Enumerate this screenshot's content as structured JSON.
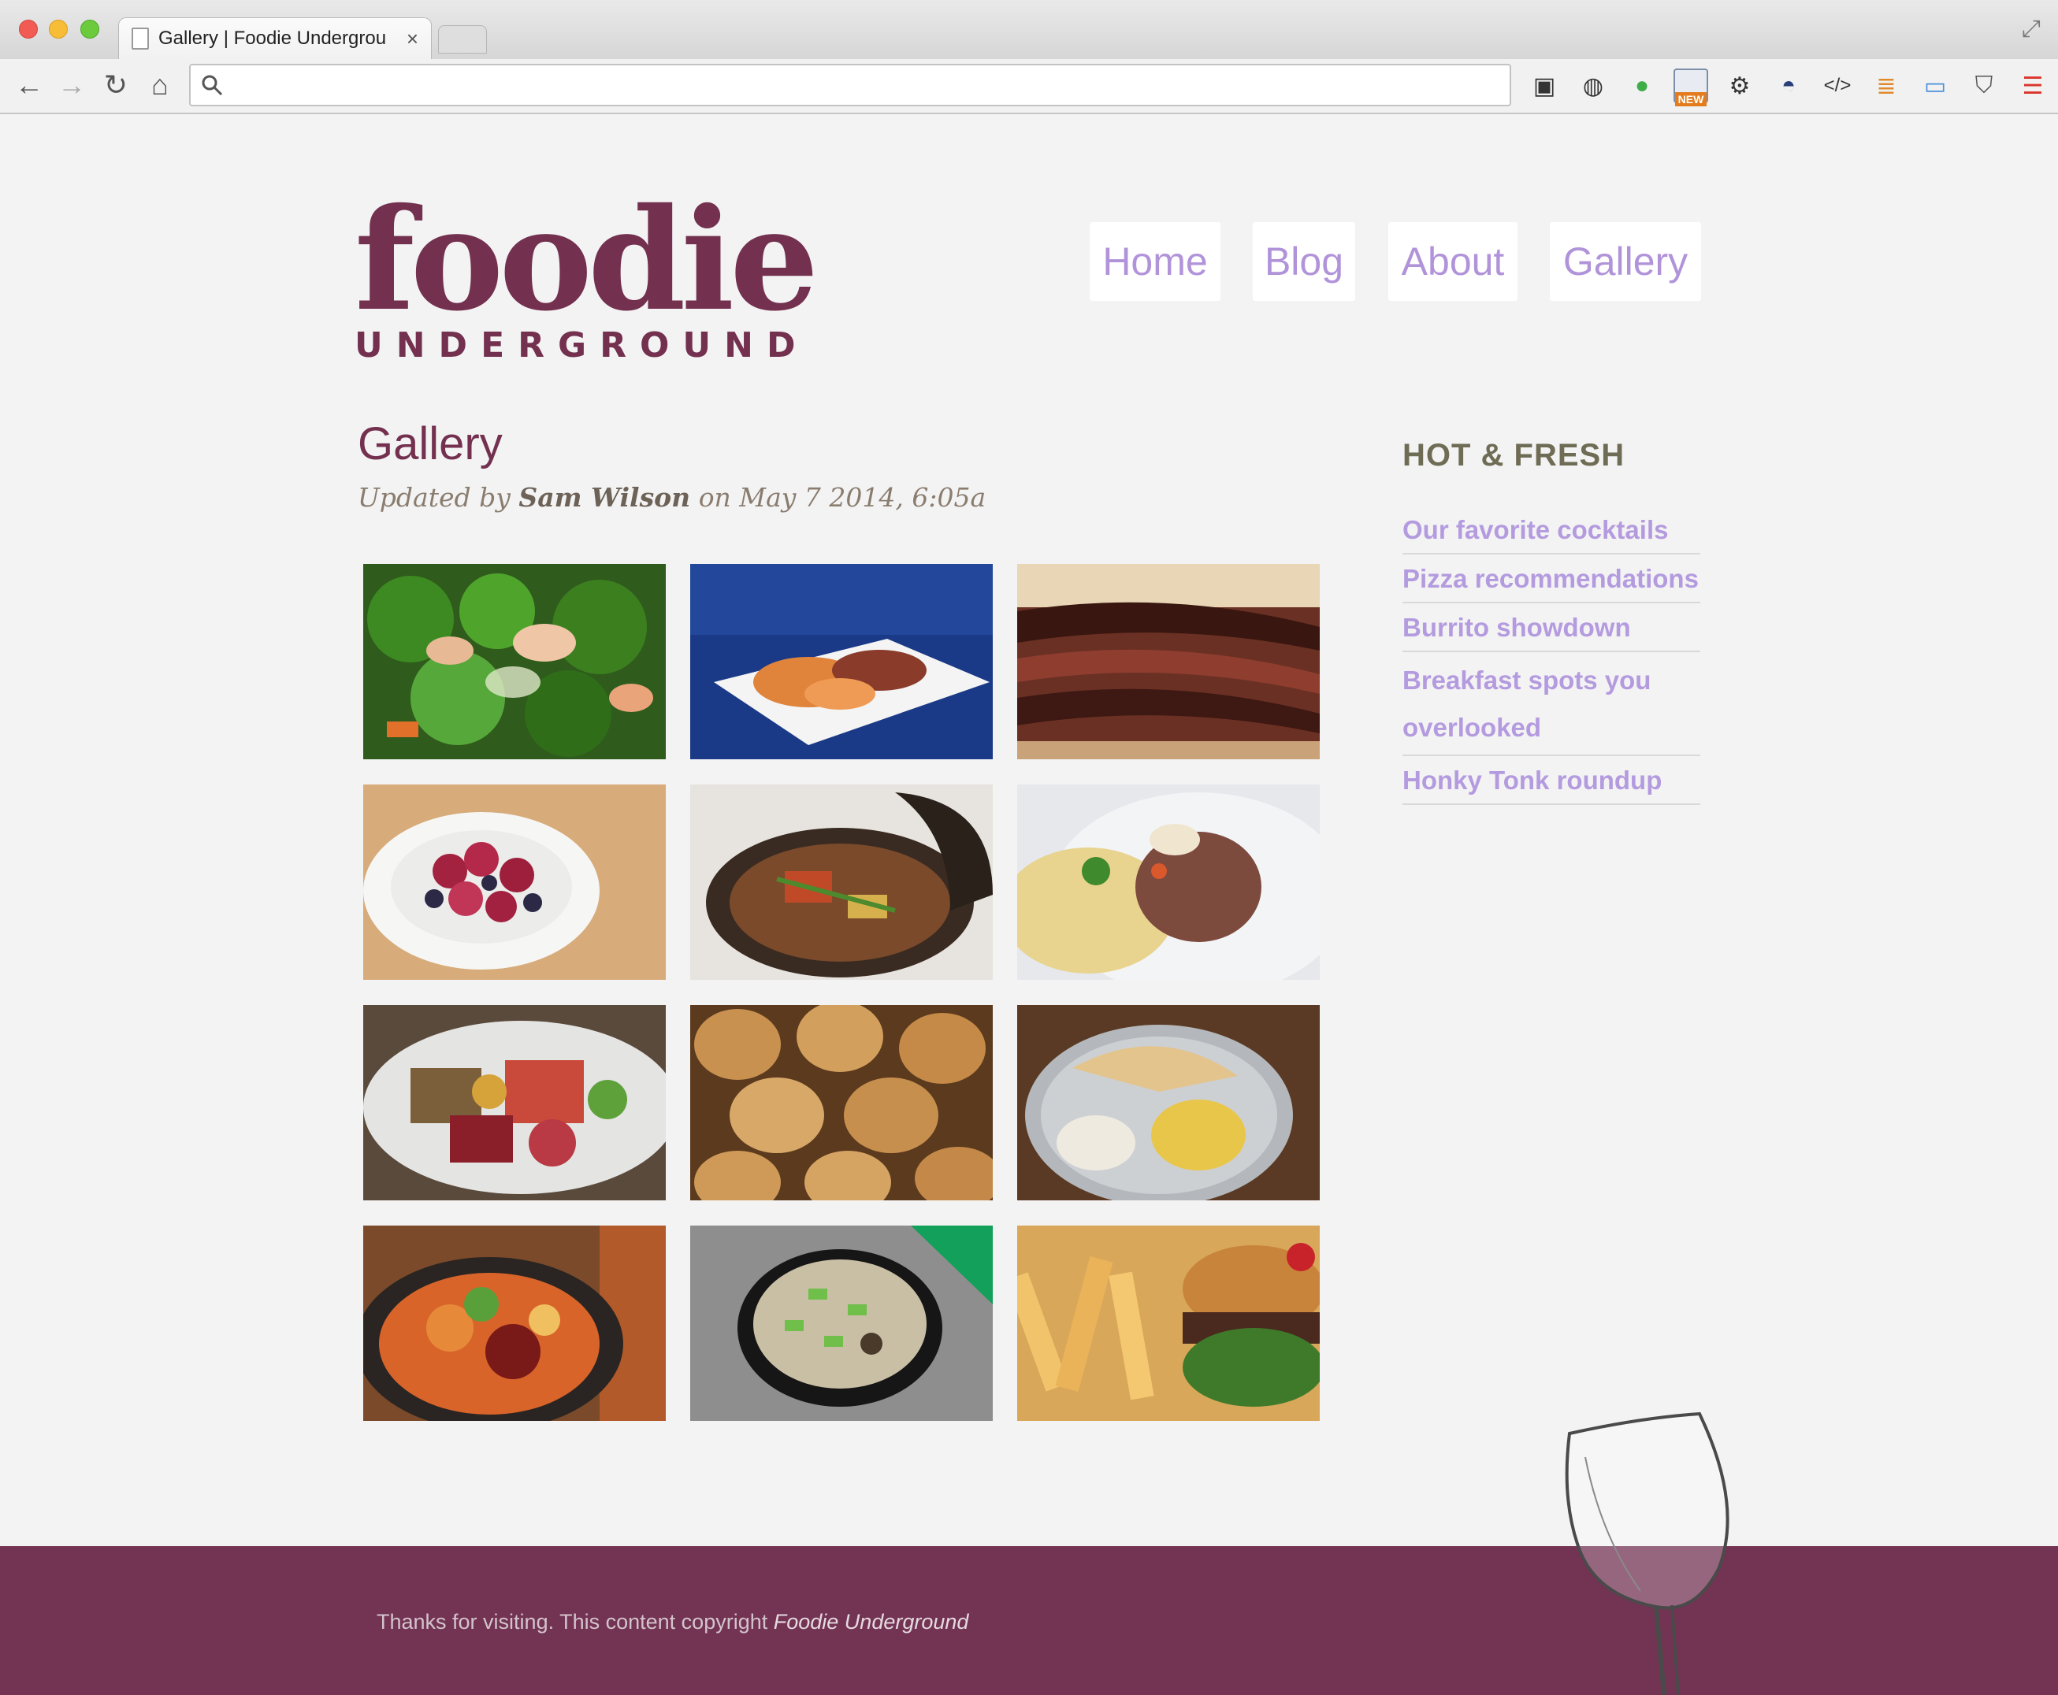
{
  "browser": {
    "tab_title": "Gallery | Foodie Undergrou",
    "tab_close": "×",
    "url_value": "",
    "extensions": [
      "camera-icon",
      "refresh-circle-icon",
      "hangouts-icon",
      "new-badge-icon",
      "gear-icon",
      "speedometer-icon",
      "code-icon",
      "stack-icon",
      "window-icon",
      "pocket-icon",
      "menu-icon"
    ],
    "new_badge": "NEW"
  },
  "site": {
    "logo_main": "foodie",
    "logo_sub": "UNDERGROUND",
    "colors": {
      "brand": "#73304f",
      "link": "#b193da",
      "background": "#f3f3f3"
    },
    "nav": [
      {
        "label": "Home"
      },
      {
        "label": "Blog"
      },
      {
        "label": "About"
      },
      {
        "label": "Gallery"
      }
    ]
  },
  "main": {
    "title": "Gallery",
    "byline_prefix": "Updated by",
    "author": "Sam Wilson",
    "byline_suffix": "on May 7 2014, 6:05a",
    "gallery": [
      {
        "subject": "broccoli and shrimp stir fry"
      },
      {
        "subject": "sweet potato plate on blue"
      },
      {
        "subject": "brisket sandwich"
      },
      {
        "subject": "raspberries and blueberries"
      },
      {
        "subject": "clay pot stew"
      },
      {
        "subject": "osso buco with rice"
      },
      {
        "subject": "sushi platter"
      },
      {
        "subject": "bread rolls"
      },
      {
        "subject": "tortilla thali"
      },
      {
        "subject": "bibimbap bowl"
      },
      {
        "subject": "soup with scallions"
      },
      {
        "subject": "burger and fries"
      }
    ]
  },
  "sidebar": {
    "title": "HOT & FRESH",
    "links": [
      {
        "label": "Our favorite cocktails"
      },
      {
        "label": "Pizza recommendations"
      },
      {
        "label": "Burrito showdown"
      },
      {
        "label": "Breakfast spots you overlooked"
      },
      {
        "label": "Honky Tonk roundup"
      }
    ]
  },
  "footer": {
    "text": "Thanks for visiting. This content copyright",
    "brand": "Foodie Underground"
  }
}
